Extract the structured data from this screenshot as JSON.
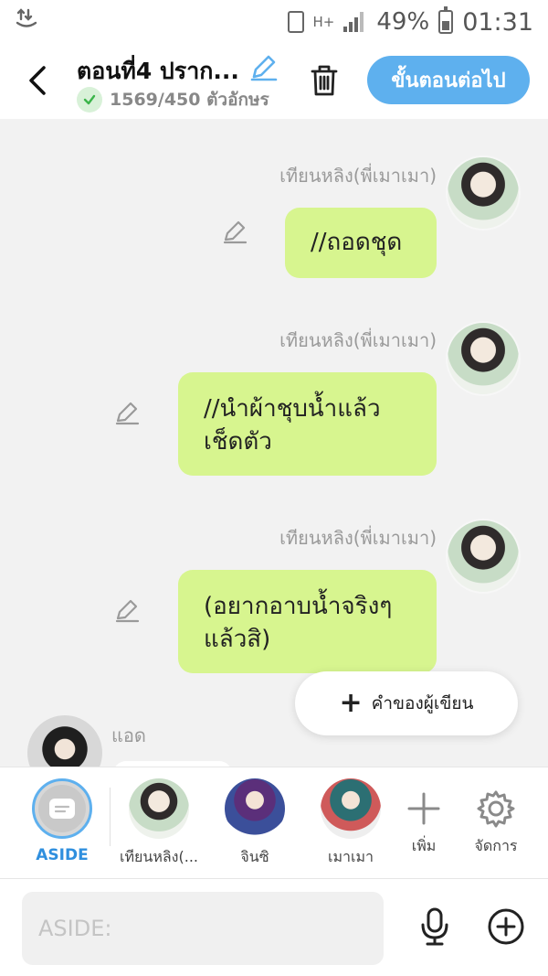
{
  "status_bar": {
    "battery": "49%",
    "time": "01:31",
    "network": "H+"
  },
  "header": {
    "title": "ตอนที่4 ปราก...",
    "char_count": "1569/450 ตัวอักษร",
    "next_button": "ขั้นตอนต่อไป"
  },
  "messages": [
    {
      "name": "เทียนหลิง(พี่เมาเมา)",
      "text": "//ถอดชุด"
    },
    {
      "name": "เทียนหลิง(พี่เมาเมา)",
      "line1": "//นำผ้าชุบน้ำแล้ว",
      "line2": "เช็ดตัว"
    },
    {
      "name": "เทียนหลิง(พี่เมาเมา)",
      "line1": "(อยากอาบน้ำจริงๆ",
      "line2": "แล้วสิ)"
    }
  ],
  "author_button": "คำของผู้เขียน",
  "admin": {
    "name": "แอด"
  },
  "characters": [
    {
      "label": "ASIDE"
    },
    {
      "label": "เทียนหลิง(..."
    },
    {
      "label": "จินซิ"
    },
    {
      "label": "เมาเมา"
    },
    {
      "label": "เพิ่ม"
    },
    {
      "label": "จัดการ"
    }
  ],
  "input": {
    "placeholder": "ASIDE:"
  },
  "colors": {
    "accent": "#5eb0ee",
    "bubble": "#d7f58f",
    "background": "#f2f2f2"
  }
}
